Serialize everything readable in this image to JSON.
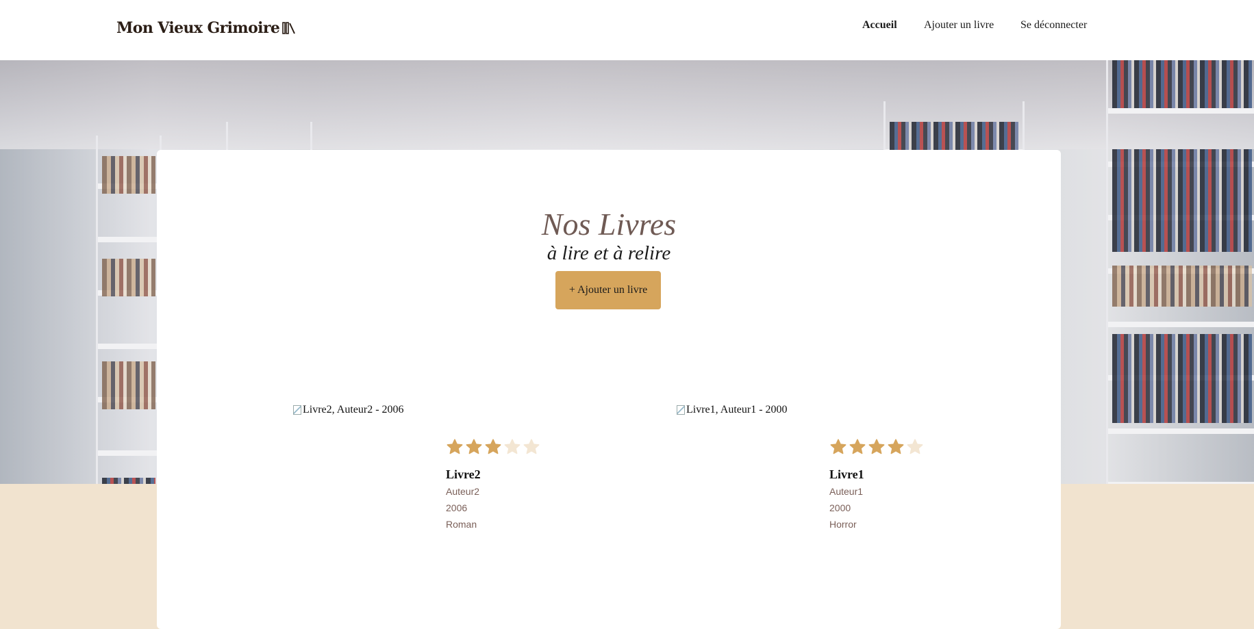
{
  "header": {
    "logo_text": "Mon Vieux Grimoire",
    "logo_icon": "books-icon",
    "nav": [
      {
        "label": "Accueil",
        "active": true
      },
      {
        "label": "Ajouter un livre",
        "active": false
      },
      {
        "label": "Se déconnecter",
        "active": false
      }
    ]
  },
  "main": {
    "title": "Nos Livres",
    "subtitle": "à lire et à relire",
    "add_button": "+ Ajouter un livre"
  },
  "books": [
    {
      "image_alt": "Livre2, Auteur2 - 2006",
      "rating": 3,
      "max_rating": 5,
      "title": "Livre2",
      "author": "Auteur2",
      "year": "2006",
      "genre": "Roman"
    },
    {
      "image_alt": "Livre1, Auteur1 - 2000",
      "rating": 4,
      "max_rating": 5,
      "title": "Livre1",
      "author": "Auteur1",
      "year": "2000",
      "genre": "Horror"
    }
  ],
  "colors": {
    "accent": "#d6a55c",
    "star_filled": "#d6a55c",
    "star_empty": "#f3e6d3",
    "background": "#f1e3cf",
    "meta_text": "#7a5f58"
  }
}
